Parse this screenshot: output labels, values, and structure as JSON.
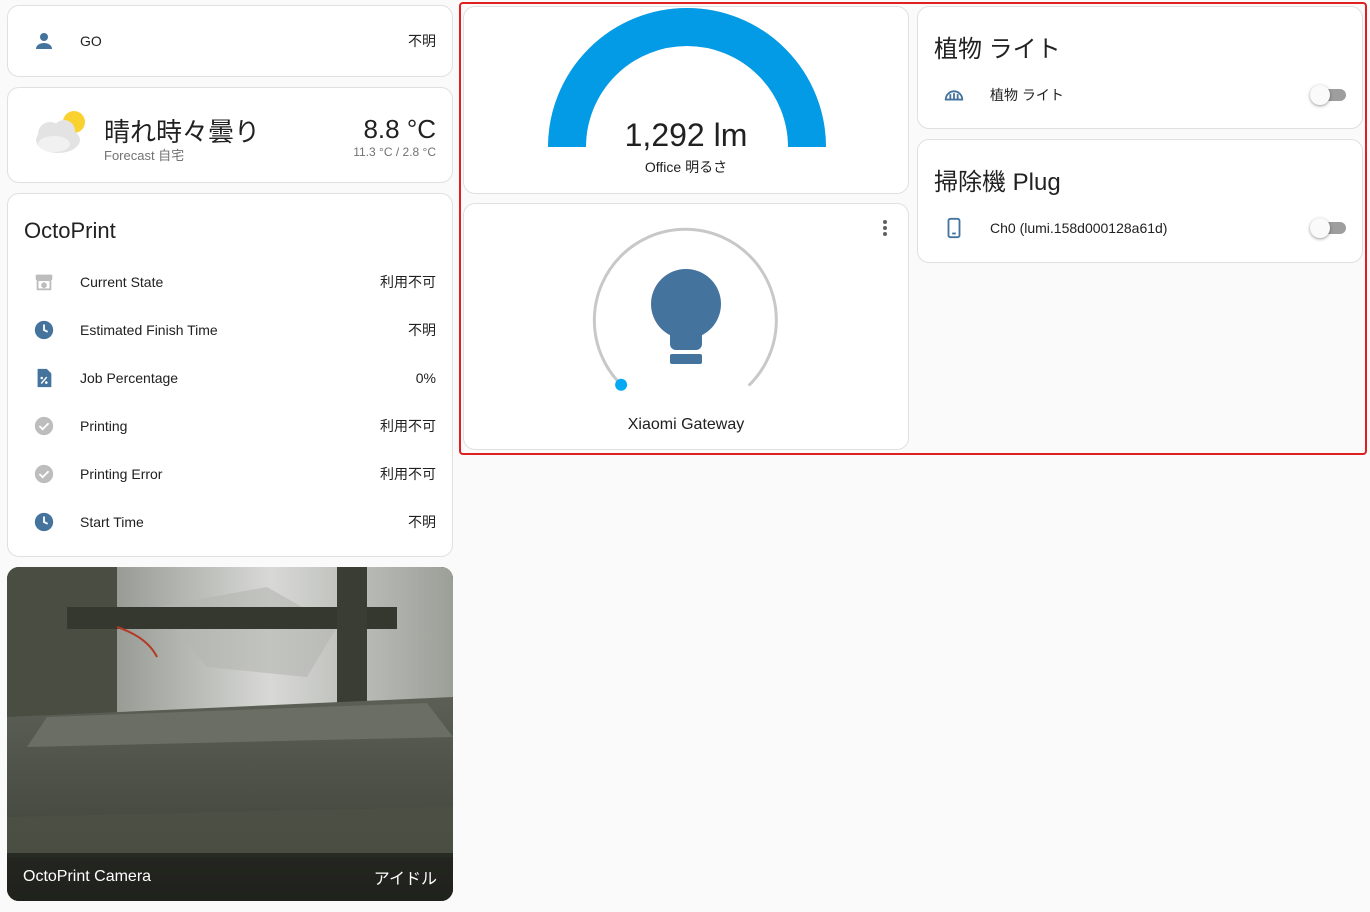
{
  "colors": {
    "icon": "#44739e",
    "gauge": "#039be5",
    "accent": "#03a9f4",
    "highlight": "#e02020"
  },
  "person": {
    "icon": "account-icon",
    "name": "GO",
    "state": "不明"
  },
  "weather": {
    "icon": "partly-cloudy-icon",
    "condition": "晴れ時々曇り",
    "forecast_label": "Forecast 自宅",
    "temperature": "8.8 °C",
    "high_low": "11.3 °C / 2.8 °C"
  },
  "octoprint": {
    "title": "OctoPrint",
    "rows": [
      {
        "icon": "printer-3d-icon",
        "label": "Current State",
        "value": "利用不可"
      },
      {
        "icon": "clock-icon",
        "label": "Estimated Finish Time",
        "value": "不明"
      },
      {
        "icon": "file-percent-icon",
        "label": "Job Percentage",
        "value": "0%"
      },
      {
        "icon": "check-circle-icon",
        "label": "Printing",
        "value": "利用不可"
      },
      {
        "icon": "check-circle-icon",
        "label": "Printing Error",
        "value": "利用不可"
      },
      {
        "icon": "clock-icon",
        "label": "Start Time",
        "value": "不明"
      }
    ]
  },
  "camera": {
    "title": "OctoPrint Camera",
    "state": "アイドル"
  },
  "gauge": {
    "value": "1,292 lm",
    "name": "Office 明るさ",
    "level": 1.0
  },
  "light": {
    "name": "Xiaomi Gateway",
    "icon": "lightbulb-icon",
    "brightness": 0
  },
  "plant_light": {
    "title": "植物 ライト",
    "row": {
      "icon": "fan-icon",
      "label": "植物 ライト",
      "on": false
    }
  },
  "vacuum_plug": {
    "title": "掃除機 Plug",
    "row": {
      "icon": "cellphone-icon",
      "label": "Ch0 (lumi.158d000128a61d)",
      "on": false
    }
  }
}
